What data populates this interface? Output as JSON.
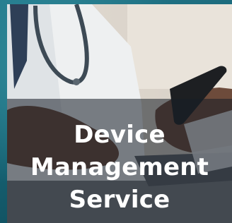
{
  "card": {
    "title_lines": [
      "Device",
      "Management",
      "Service"
    ]
  },
  "image": {
    "subject": "doctor-using-smartphone-photo"
  },
  "colors": {
    "background_teal": "#1a6f80",
    "overlay": "#161e26",
    "title_text": "#ffffff"
  }
}
